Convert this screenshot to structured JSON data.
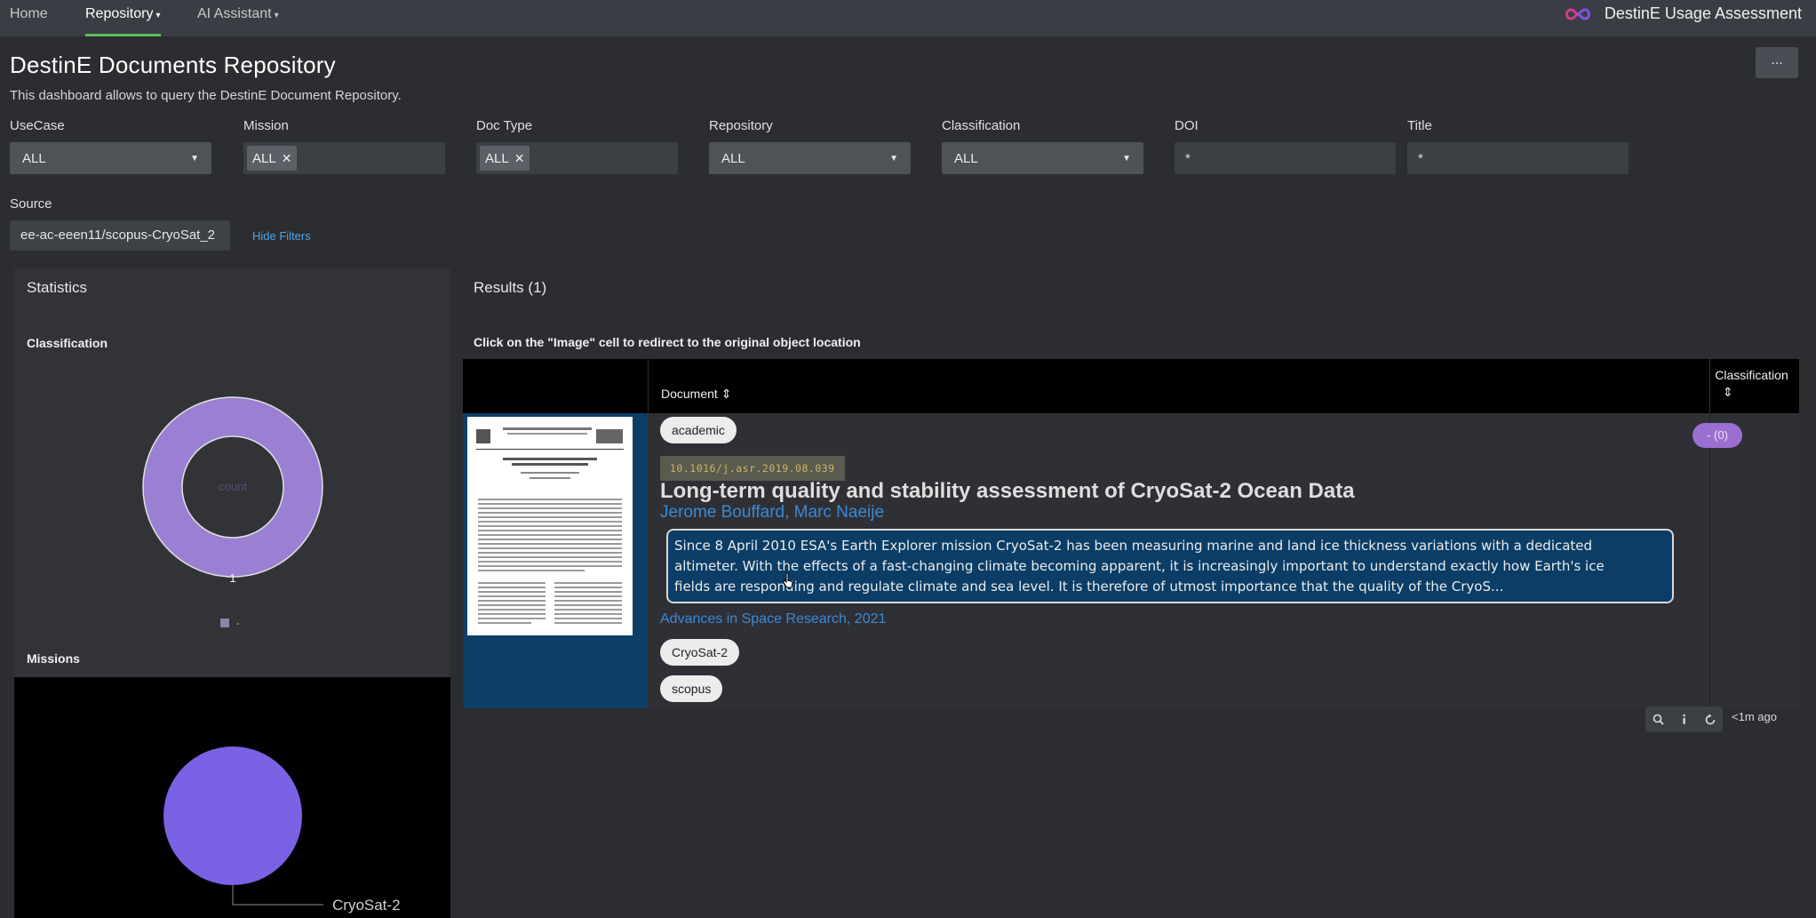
{
  "nav": {
    "items": [
      {
        "label": "Home"
      },
      {
        "label": "Repository"
      },
      {
        "label": "AI Assistant"
      }
    ],
    "brand_title": "DestinE Usage Assessment",
    "caret": "▾"
  },
  "page": {
    "title": "DestinE Documents Repository",
    "description": "This dashboard allows to query the DestinE Document Repository.",
    "more_label": "..."
  },
  "filters": {
    "usecase": {
      "label": "UseCase",
      "value": "ALL"
    },
    "mission": {
      "label": "Mission",
      "chip": "ALL"
    },
    "doctype": {
      "label": "Doc Type",
      "chip": "ALL"
    },
    "repository": {
      "label": "Repository",
      "value": "ALL"
    },
    "classification": {
      "label": "Classification",
      "value": "ALL"
    },
    "doi": {
      "label": "DOI",
      "value": "*"
    },
    "title": {
      "label": "Title",
      "value": "*"
    },
    "source": {
      "label": "Source",
      "value": "ee-ac-eeen11/scopus-CryoSat_2"
    },
    "hide_filters": "Hide Filters"
  },
  "statistics": {
    "title": "Statistics",
    "classification_title": "Classification",
    "donut_center": "count",
    "donut_value_label": "1",
    "legend_text": "-",
    "missions_title": "Missions",
    "mission_label": "CryoSat-2"
  },
  "results": {
    "title": "Results (1)",
    "hint": "Click on the \"Image\" cell to redirect to the original object location",
    "columns": {
      "document": "Document",
      "classification": "Classification",
      "sort_icon": "⇕"
    },
    "row": {
      "type_tag": "academic",
      "doi": "10.1016/j.asr.2019.08.039",
      "title": "Long-term quality and stability assessment of CryoSat-2 Ocean Data",
      "authors": "Jerome Bouffard, Marc Naeije",
      "abstract_line1": "Since 8 April 2010 ESA's Earth Explorer mission CryoSat-2 has been measuring marine and land ice thickness variations with a dedicated",
      "abstract_line2": "altimeter. With the effects of a fast-changing climate becoming apparent, it is increasingly important to understand exactly how Earth's ice",
      "abstract_line3": "fields are responding and regulate climate and sea level. It is therefore of utmost importance that the quality of the CryoS...",
      "journal": "Advances in Space Research, 2021",
      "mission_tag": "CryoSat-2",
      "source_tag": "scopus",
      "classification_badge": "- (0)"
    },
    "updated": "<1m ago"
  },
  "colors": {
    "donut": "#9b7fd3",
    "mission_pie": "#7b61e3",
    "link": "#3a8ad6",
    "accent_underline": "#5cc05c"
  },
  "chart_data": [
    {
      "type": "pie",
      "title": "Classification",
      "categories": [
        "-"
      ],
      "values": [
        1
      ],
      "legend": "bottom"
    },
    {
      "type": "pie",
      "title": "Missions",
      "categories": [
        "CryoSat-2"
      ],
      "values": [
        1
      ]
    }
  ]
}
